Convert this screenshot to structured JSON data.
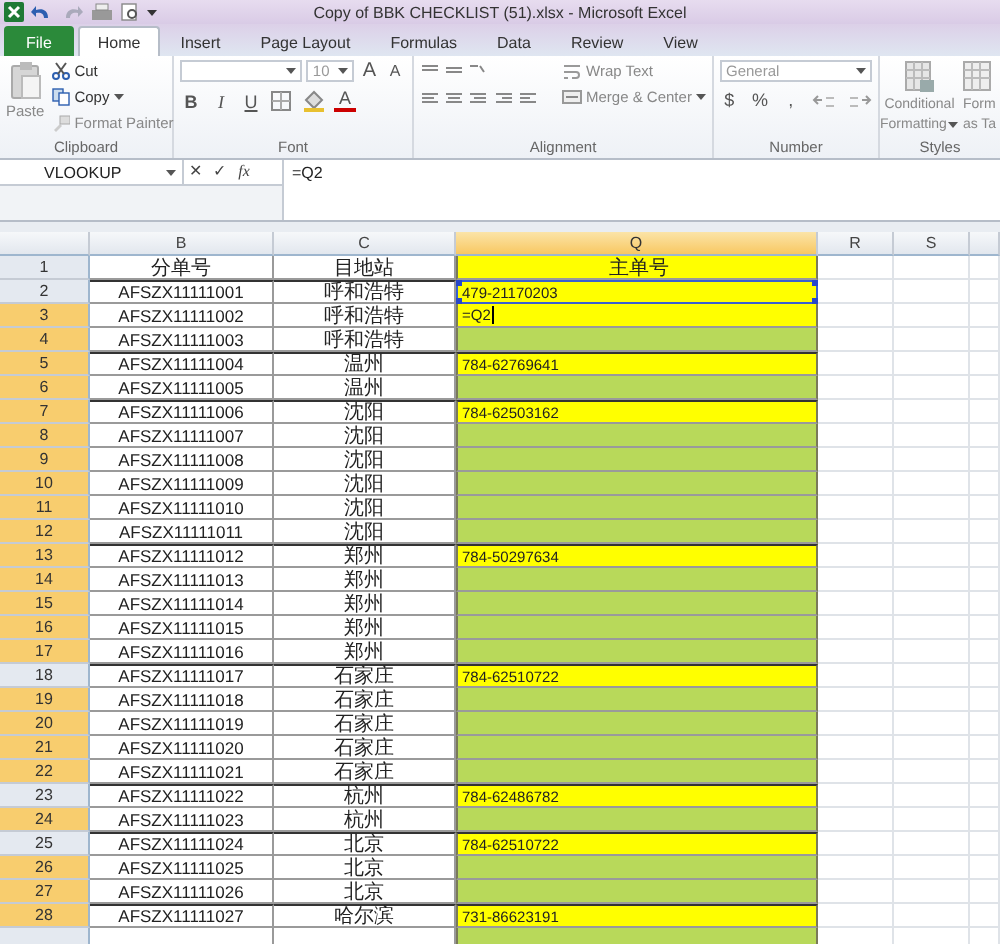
{
  "window": {
    "title": "Copy of BBK CHECKLIST (51).xlsx - Microsoft Excel"
  },
  "tabs": [
    {
      "label": "File",
      "kind": "file",
      "selected": false
    },
    {
      "label": "Home",
      "kind": "tab",
      "selected": true
    },
    {
      "label": "Insert",
      "kind": "tab",
      "selected": false
    },
    {
      "label": "Page Layout",
      "kind": "tab",
      "selected": false
    },
    {
      "label": "Formulas",
      "kind": "tab",
      "selected": false
    },
    {
      "label": "Data",
      "kind": "tab",
      "selected": false
    },
    {
      "label": "Review",
      "kind": "tab",
      "selected": false
    },
    {
      "label": "View",
      "kind": "tab",
      "selected": false
    }
  ],
  "ribbon": {
    "clipboard": {
      "label": "Clipboard",
      "paste": "Paste",
      "cut": "Cut",
      "copy": "Copy",
      "format_painter": "Format Painter"
    },
    "font": {
      "label": "Font",
      "size": "10",
      "buttons": [
        {
          "kind": "grow",
          "label": "A"
        },
        {
          "kind": "shrink",
          "label": "A"
        },
        {
          "kind": "bold",
          "label": "B"
        },
        {
          "kind": "italic",
          "label": "I"
        },
        {
          "kind": "underline",
          "label": "U"
        },
        {
          "kind": "borders"
        },
        {
          "kind": "fill"
        },
        {
          "kind": "color",
          "label": "A"
        }
      ]
    },
    "alignment": {
      "label": "Alignment",
      "wrap_text": "Wrap Text",
      "merge_center": "Merge & Center"
    },
    "number": {
      "label": "Number",
      "format": "General",
      "buttons": [
        "$",
        "%",
        ","
      ]
    },
    "styles": {
      "label": "Styles",
      "conditional": [
        "Conditional",
        "Formatting"
      ],
      "table": [
        "Form",
        "as Ta"
      ]
    }
  },
  "formula_bar": {
    "name_box": "VLOOKUP",
    "cancel": "✕",
    "enter": "✓",
    "fx": "fx",
    "formula": "=Q2"
  },
  "columns": [
    {
      "label": "B",
      "selected": false
    },
    {
      "label": "C",
      "selected": false
    },
    {
      "label": "Q",
      "selected": true
    },
    {
      "label": "R",
      "selected": false
    },
    {
      "label": "S",
      "selected": false
    }
  ],
  "rows": [
    {
      "num": "1",
      "b": "分单号",
      "c": "目地站",
      "q": "主单号",
      "color": "#ffff00",
      "selected": false,
      "editing": false,
      "referenced": false
    },
    {
      "num": "2",
      "b": "AFSZX11111001",
      "c": "呼和浩特",
      "q": "479-21170203",
      "color": "#ffff00",
      "selected": false,
      "editing": false,
      "referenced": true
    },
    {
      "num": "3",
      "b": "AFSZX11111002",
      "c": "呼和浩特",
      "q": "=Q2",
      "color": "#ffff00",
      "selected": true,
      "editing": true,
      "referenced": false
    },
    {
      "num": "4",
      "b": "AFSZX11111003",
      "c": "呼和浩特",
      "color": "#b8d95a",
      "selected": true,
      "editing": false,
      "referenced": false
    },
    {
      "num": "5",
      "b": "AFSZX11111004",
      "c": "温州",
      "q": "784-62769641",
      "color": "#ffff00",
      "selected": true,
      "editing": false,
      "referenced": false
    },
    {
      "num": "6",
      "b": "AFSZX11111005",
      "c": "温州",
      "color": "#b8d95a",
      "selected": true,
      "editing": false,
      "referenced": false
    },
    {
      "num": "7",
      "b": "AFSZX11111006",
      "c": "沈阳",
      "q": "784-62503162",
      "color": "#ffff00",
      "selected": true,
      "editing": false,
      "referenced": false
    },
    {
      "num": "8",
      "b": "AFSZX11111007",
      "c": "沈阳",
      "color": "#b8d95a",
      "selected": true,
      "editing": false,
      "referenced": false
    },
    {
      "num": "9",
      "b": "AFSZX11111008",
      "c": "沈阳",
      "color": "#b8d95a",
      "selected": true,
      "editing": false,
      "referenced": false
    },
    {
      "num": "10",
      "b": "AFSZX11111009",
      "c": "沈阳",
      "color": "#b8d95a",
      "selected": true,
      "editing": false,
      "referenced": false
    },
    {
      "num": "11",
      "b": "AFSZX11111010",
      "c": "沈阳",
      "color": "#b8d95a",
      "selected": true,
      "editing": false,
      "referenced": false
    },
    {
      "num": "12",
      "b": "AFSZX11111011",
      "c": "沈阳",
      "color": "#b8d95a",
      "selected": true,
      "editing": false,
      "referenced": false
    },
    {
      "num": "13",
      "b": "AFSZX11111012",
      "c": "郑州",
      "q": "784-50297634",
      "color": "#ffff00",
      "selected": true,
      "editing": false,
      "referenced": false
    },
    {
      "num": "14",
      "b": "AFSZX11111013",
      "c": "郑州",
      "color": "#b8d95a",
      "selected": true,
      "editing": false,
      "referenced": false
    },
    {
      "num": "15",
      "b": "AFSZX11111014",
      "c": "郑州",
      "color": "#b8d95a",
      "selected": true,
      "editing": false,
      "referenced": false
    },
    {
      "num": "16",
      "b": "AFSZX11111015",
      "c": "郑州",
      "color": "#b8d95a",
      "selected": true,
      "editing": false,
      "referenced": false
    },
    {
      "num": "17",
      "b": "AFSZX11111016",
      "c": "郑州",
      "color": "#b8d95a",
      "selected": true,
      "editing": false,
      "referenced": false
    },
    {
      "num": "18",
      "b": "AFSZX11111017",
      "c": "石家庄",
      "q": "784-62510722",
      "color": "#ffff00",
      "selected": false,
      "editing": false,
      "referenced": false
    },
    {
      "num": "19",
      "b": "AFSZX11111018",
      "c": "石家庄",
      "color": "#b8d95a",
      "selected": true,
      "editing": false,
      "referenced": false
    },
    {
      "num": "20",
      "b": "AFSZX11111019",
      "c": "石家庄",
      "color": "#b8d95a",
      "selected": true,
      "editing": false,
      "referenced": false
    },
    {
      "num": "21",
      "b": "AFSZX11111020",
      "c": "石家庄",
      "color": "#b8d95a",
      "selected": true,
      "editing": false,
      "referenced": false
    },
    {
      "num": "22",
      "b": "AFSZX11111021",
      "c": "石家庄",
      "color": "#b8d95a",
      "selected": true,
      "editing": false,
      "referenced": false
    },
    {
      "num": "23",
      "b": "AFSZX11111022",
      "c": "杭州",
      "q": "784-62486782",
      "color": "#ffff00",
      "selected": false,
      "editing": false,
      "referenced": false
    },
    {
      "num": "24",
      "b": "AFSZX11111023",
      "c": "杭州",
      "color": "#b8d95a",
      "selected": true,
      "editing": false,
      "referenced": false
    },
    {
      "num": "25",
      "b": "AFSZX11111024",
      "c": "北京",
      "q": "784-62510722",
      "color": "#ffff00",
      "selected": false,
      "editing": false,
      "referenced": false
    },
    {
      "num": "26",
      "b": "AFSZX11111025",
      "c": "北京",
      "color": "#b8d95a",
      "selected": true,
      "editing": false,
      "referenced": false
    },
    {
      "num": "27",
      "b": "AFSZX11111026",
      "c": "北京",
      "color": "#b8d95a",
      "selected": true,
      "editing": false,
      "referenced": false
    },
    {
      "num": "28",
      "b": "AFSZX11111027",
      "c": "哈尔滨",
      "q": "731-86623191",
      "color": "#ffff00",
      "selected": true,
      "editing": false,
      "referenced": false
    }
  ]
}
